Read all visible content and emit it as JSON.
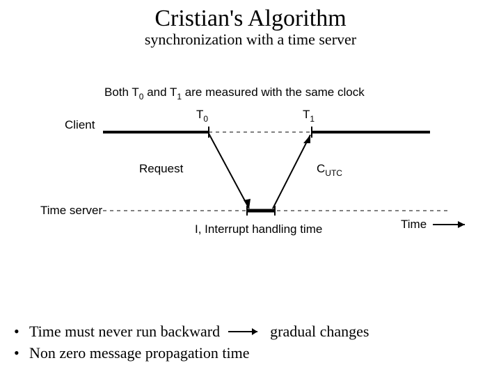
{
  "title": "Cristian's Algorithm",
  "subtitle": "synchronization with a time server",
  "diagram": {
    "topNote": "Both T",
    "topNote0": "0",
    "topNoteMid": " and T",
    "topNote1": "1",
    "topNoteTail": " are measured with the same clock",
    "client": "Client",
    "t0": "T",
    "t0sub": "0",
    "t1": "T",
    "t1sub": "1",
    "request": "Request",
    "cutc": "C",
    "cutcSub": "UTC",
    "timeServer": "Time server",
    "handlingTime": "I, Interrupt handling time",
    "timeAxis": "Time"
  },
  "bullets": {
    "b1a": "Time must never run backward",
    "b1b": "gradual changes",
    "b2": "Non zero message propagation time"
  }
}
